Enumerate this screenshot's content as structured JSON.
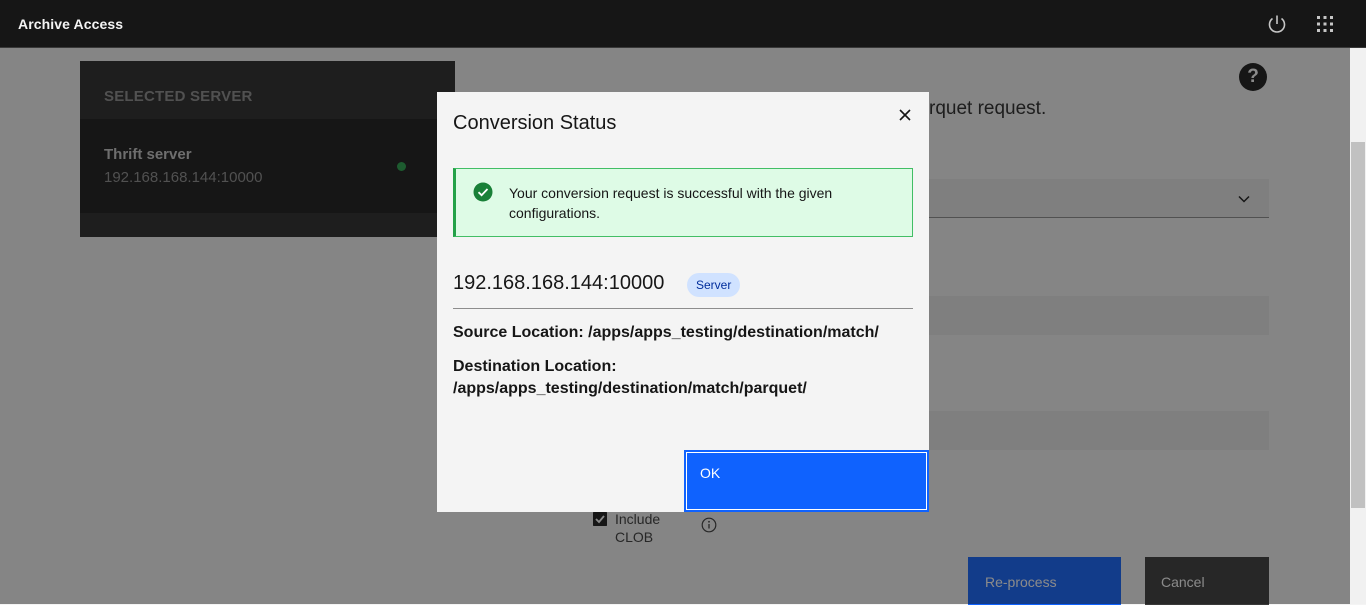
{
  "header": {
    "app_title": "Archive Access",
    "power_icon": "power-icon",
    "switcher_icon": "app-switcher-grid-icon"
  },
  "server_panel": {
    "heading": "SELECTED SERVER",
    "server_name": "Thrift server",
    "server_address": "192.168.168.144:10000",
    "status_color": "#24a148"
  },
  "background_form": {
    "heading_fragment": "rquet request.",
    "include_clob_label": "Include CLOB",
    "include_clob_checked": true,
    "reprocess_label": "Re-process",
    "cancel_label": "Cancel"
  },
  "modal": {
    "title": "Conversion Status",
    "notification_text": "Your conversion request is successful with the given configurations.",
    "server_address": "192.168.168.144:10000",
    "server_tag": "Server",
    "source_location": "Source Location: /apps/apps_testing/destination/match/",
    "destination_label": "Destination Location:",
    "destination_path": "/apps/apps_testing/destination/match/parquet/",
    "ok_label": "OK"
  },
  "colors": {
    "header_bg": "#161616",
    "primary": "#0f62fe",
    "success": "#24a148",
    "notification_bg": "#defbe6",
    "tag_bg": "#d0e2ff"
  }
}
